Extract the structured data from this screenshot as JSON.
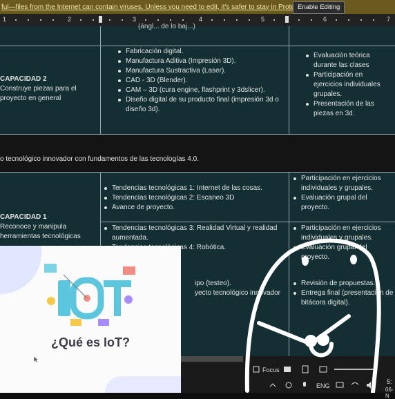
{
  "protected_view": {
    "message": "ful—files from the Internet can contain viruses. Unless you need to edit, it's safer to stay in Protected View.",
    "enable_button": "Enable Editing"
  },
  "ruler": {
    "numbers": [
      "1",
      "2",
      "3",
      "4",
      "5",
      "6",
      "7"
    ]
  },
  "table": {
    "top_cut_text": "(ángl... de lo baj...)",
    "cap2": {
      "title": "CAPACIDAD 2",
      "desc_lines": [
        "Construye piezas para el",
        "proyecto en general"
      ],
      "content": [
        "Fabricación digital.",
        "Manufactura Aditiva (Impresión 3D).",
        "Manufactura Sustractiva (Laser).",
        "CAD - 3D (Blender).",
        "CAM – 3D (cura engine, flashprint y 3dslicer).",
        "Diseño digital de su producto final (impresión 3d o diseño 3d)."
      ],
      "eval": [
        "Evaluación teórica durante las clases",
        "Participación en ejercicios individuales grupales.",
        "Presentación de las piezas en 3d."
      ]
    },
    "band_text": "o tecnológico innovador con fundamentos de las tecnologías 4.0.",
    "cap1": {
      "title": "CAPACIDAD 1",
      "desc_lines": [
        "Reconoce y manipula",
        "herramientas tecnológicas"
      ],
      "content_a": [
        "Tendencias tecnológicas 1: Internet de las cosas.",
        "Tendencias tecnológicas 2: Escaneo 3D",
        "Avance de proyecto."
      ],
      "eval_a": [
        "Participación en ejercicios individuales y grupales.",
        "Evaluación grupal del proyecto."
      ],
      "content_b": [
        "Tendencias tecnológicas 3: Realidad Virtual y realidad aumentada.",
        "Tendencias tecnológicas 4: Robótica."
      ],
      "eval_b": [
        "Participación en ejercicios individuales y grupales.",
        "Evaluación grupal del proyecto."
      ],
      "content_c_lines": [
        "ipo (testeo).",
        "yecto tecnológico innovador"
      ],
      "eval_c": [
        "Revisión de propuestas.",
        "Entrega final (presentación de bitácora digital)."
      ]
    }
  },
  "slide": {
    "logo_text": "IOT",
    "title": "¿Qué es IoT?"
  },
  "taskbar": {
    "focus_label": "Focus",
    "lang": "ENG",
    "time_fragment": "5:",
    "date_fragment": "06-N"
  }
}
